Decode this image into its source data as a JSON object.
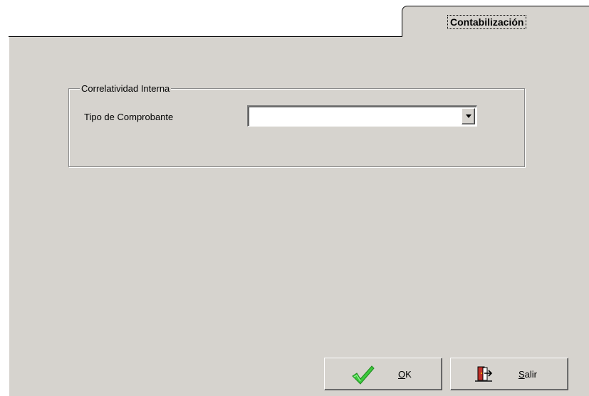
{
  "tabs": [
    {
      "label": "Contabilización",
      "active": true
    }
  ],
  "group": {
    "title": "Correlatividad Interna",
    "field": {
      "label": "Tipo de Comprobante",
      "value": "",
      "icon": "chevron-down-icon"
    }
  },
  "buttons": {
    "ok": {
      "mnemonic": "O",
      "rest": "K",
      "icon": "checkmark-icon",
      "icon_color": "#3cc83c"
    },
    "exit": {
      "mnemonic": "S",
      "rest": "alir",
      "icon": "exit-door-icon",
      "icon_color": "#c0302a"
    }
  },
  "colors": {
    "face": "#d6d3ce",
    "window": "#ffffff"
  }
}
